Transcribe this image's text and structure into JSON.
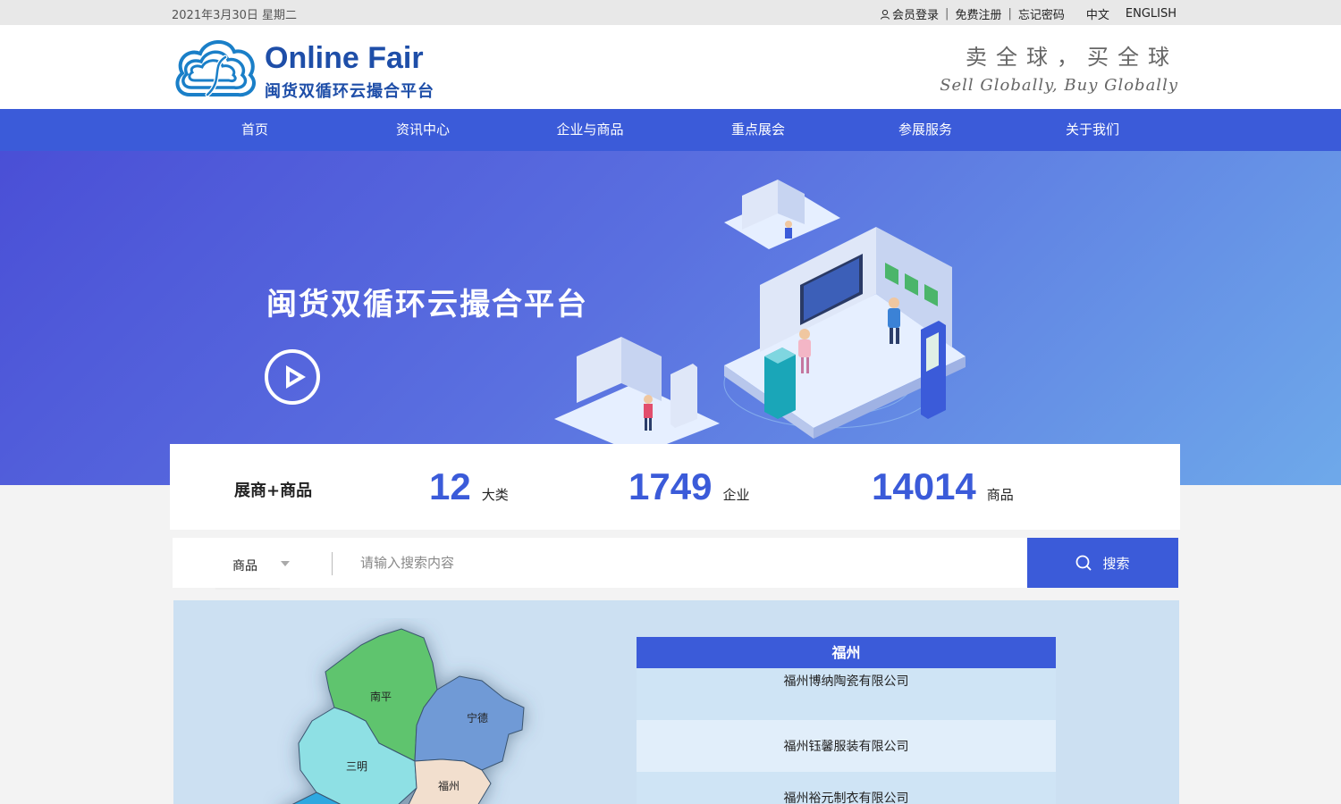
{
  "topbar": {
    "date": "2021年3月30日 星期二",
    "login": "会员登录",
    "register": "免费注册",
    "forgot": "忘记密码",
    "lang_cn": "中文",
    "lang_en": "ENGLISH"
  },
  "header": {
    "logo_en": "Online Fair",
    "logo_cn": "闽货双循环云撮合平台",
    "slogan_cn": "卖全球，买全球",
    "slogan_en": "Sell Globally, Buy Globally"
  },
  "nav": {
    "items": [
      "首页",
      "资讯中心",
      "企业与商品",
      "重点展会",
      "参展服务",
      "关于我们"
    ]
  },
  "banner": {
    "title": "闽货双循环云撮合平台"
  },
  "stats": {
    "label": "展商+商品",
    "categories": {
      "value": "12",
      "unit": "大类"
    },
    "companies": {
      "value": "1749",
      "unit": "企业"
    },
    "products": {
      "value": "14014",
      "unit": "商品"
    }
  },
  "search": {
    "type": "商品",
    "placeholder": "请输入搜索内容",
    "button": "搜索"
  },
  "map": {
    "regions": [
      "南平",
      "宁德",
      "三明",
      "福州"
    ],
    "colors": {
      "nanping": "#5fc46e",
      "ningde": "#6f9ad6",
      "sanming": "#8ee0e4",
      "fuzhou": "#f2dfce"
    }
  },
  "companies": {
    "city": "福州",
    "items": [
      "福州博纳陶瓷有限公司",
      "福州钰馨服装有限公司",
      "福州裕元制衣有限公司"
    ]
  }
}
